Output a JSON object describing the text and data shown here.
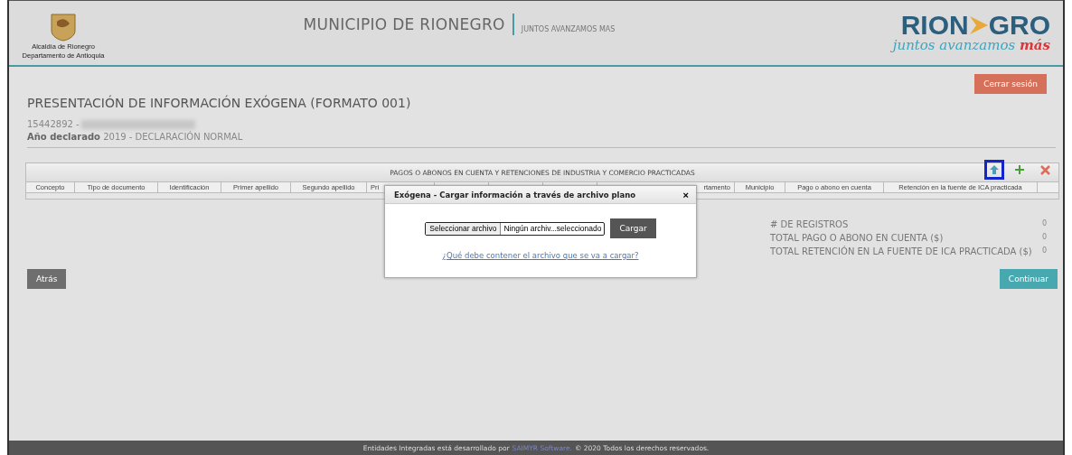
{
  "header": {
    "seal_caption": [
      "Alcaldía de Rionegro",
      "Departamento de Antioquia"
    ],
    "title": "MUNICIPIO DE RIONEGRO",
    "subtitle": "JUNTOS AVANZAMOS MAS",
    "logo": {
      "word_start": "RION",
      "word_end": "GRO",
      "tagline": "juntos avanzamos",
      "tagline_accent": "más"
    }
  },
  "logout_button": "Cerrar sesión",
  "page_title": "PRESENTACIÓN DE INFORMACIÓN EXÓGENA (FORMATO 001)",
  "taxpayer_id": "15442892 -",
  "declared_year": {
    "label": "Año declarado",
    "value": "2019 - DECLARACIÓN NORMAL"
  },
  "table": {
    "title": "PAGOS O ABONOS EN CUENTA Y RETENCIONES DE INDUSTRIA Y COMERCIO PRACTICADAS",
    "toolbar": [
      {
        "kind": "upload",
        "highlighted": true
      },
      {
        "kind": "add",
        "highlighted": false
      },
      {
        "kind": "delete",
        "highlighted": false
      }
    ],
    "columns": [
      "Concepto",
      "Tipo de documento",
      "Identificación",
      "Primer apellido",
      "Segundo apellido",
      "Pri",
      "rtamento",
      "Municipio",
      "Pago o abono en cuenta",
      "Retención en la fuente de ICA practicada"
    ]
  },
  "totals": [
    {
      "label": "# DE REGISTROS",
      "value": "0"
    },
    {
      "label": "TOTAL PAGO O ABONO EN CUENTA ($)",
      "value": "0"
    },
    {
      "label": "TOTAL RETENCIÓN EN LA FUENTE DE ICA PRACTICADA ($)",
      "value": "0"
    }
  ],
  "back_button": "Atrás",
  "continue_button": "Continuar",
  "dialog": {
    "title": "Exógena - Cargar información a través de archivo plano",
    "close": "×",
    "file_button": "Seleccionar archivo",
    "file_status": "Ningún archiv...seleccionado",
    "upload_button": "Cargar",
    "help_link": "¿Qué debe contener el archivo que se va a cargar?"
  },
  "footer": {
    "text_before": "Entidades Integradas está desarrollado por",
    "link": "SAIMYR Software.",
    "text_after": "© 2020 Todos los derechos reservados."
  }
}
